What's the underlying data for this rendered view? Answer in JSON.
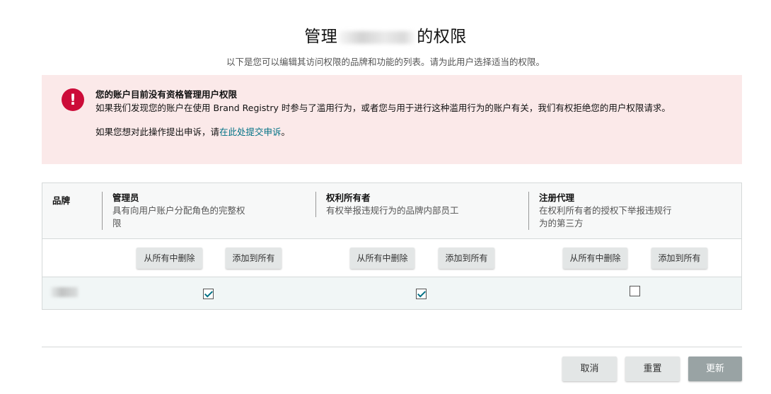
{
  "header": {
    "title_prefix": "管理",
    "title_suffix": "的权限",
    "subtitle": "以下是您可以编辑其访问权限的品牌和功能的列表。请为此用户选择适当的权限。"
  },
  "alert": {
    "icon": "exclamation-icon",
    "icon_glyph": "!",
    "title": "您的账户目前没有资格管理用户权限",
    "body": "如果我们发现您的账户在使用 Brand Registry 时参与了滥用行为，或者您与用于进行这种滥用行为的账户有关，我们有权拒绝您的用户权限请求。",
    "appeal_prefix": "如果您想对此操作提出申诉，请",
    "appeal_link": "在此处提交申诉",
    "appeal_suffix": "。",
    "colors": {
      "background": "#fbe9e9",
      "icon": "#cc0c39",
      "link": "#007185"
    }
  },
  "table": {
    "brand_header": "品牌",
    "columns": [
      {
        "name": "管理员",
        "desc_line1": "具有向用户账户分配角色的完整权",
        "desc_line2": "限",
        "remove_all": "从所有中删除",
        "add_all": "添加到所有"
      },
      {
        "name": "权利所有者",
        "desc_line1": "有权举报违规行为的品牌内部员工",
        "desc_line2": "",
        "remove_all": "从所有中删除",
        "add_all": "添加到所有"
      },
      {
        "name": "注册代理",
        "desc_line1": "在权利所有者的授权下举报违规行",
        "desc_line2": "为的第三方",
        "remove_all": "从所有中删除",
        "add_all": "添加到所有"
      }
    ],
    "rows": [
      {
        "checked": [
          true,
          true,
          false
        ]
      }
    ]
  },
  "footer": {
    "cancel_label": "取消",
    "reset_label": "重置",
    "update_label": "更新",
    "colors": {
      "update_disabled": "#99a3a4",
      "secondary": "#e3e6e6"
    }
  }
}
